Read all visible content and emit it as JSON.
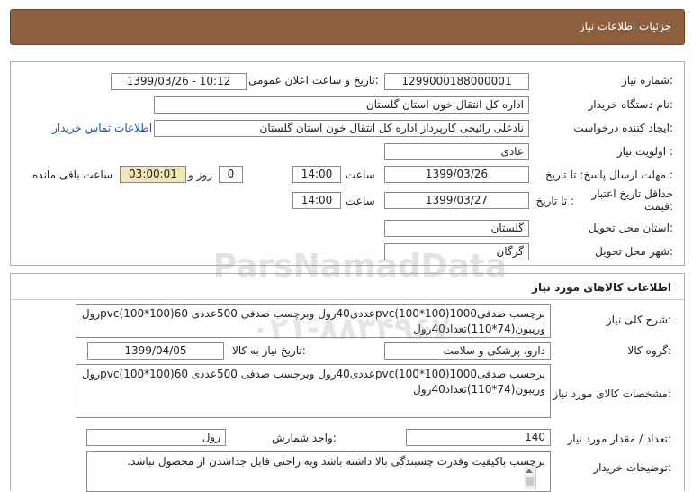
{
  "header": {
    "title": "جزئیات اطلاعات نیاز"
  },
  "need_info": {
    "need_number_label": "شماره نیاز:",
    "need_number": "1299000188000001",
    "announce_label": "تاریخ و ساعت اعلان عمومی:",
    "announce_value": "1399/03/26 - 10:12",
    "buyer_org_label": "نام دستگاه خریدار:",
    "buyer_org": "اداره کل انتقال خون استان گلستان",
    "creator_label": "ایجاد کننده درخواست:",
    "creator": "نادعلی رائیجی کارپرداز اداره کل انتقال خون استان گلستان",
    "contact_link": "اطلاعات تماس خریدار",
    "priority_label": "اولویت نیاز :",
    "priority": "عادی",
    "deadline_label": "مهلت ارسال پاسخ: تا تاریخ :",
    "deadline_date": "1399/03/26",
    "time_label": "ساعت",
    "deadline_time": "14:00",
    "days_value": "0",
    "days_label": "روز و",
    "remaining_value": "03:00:01",
    "remaining_label": "ساعت باقی مانده",
    "validity_label": "حداقل تاریخ اعتبار قیمت:",
    "validity_to_label": "تا تاریخ :",
    "validity_date": "1399/03/27",
    "validity_time": "14:00",
    "province_label": "استان محل تحویل:",
    "province": "گلستان",
    "city_label": "شهر محل تحویل:",
    "city": "گرگان"
  },
  "goods": {
    "section_title": "اطلاعات کالاهای مورد نیاز",
    "summary_label": "شرح کلی نیاز:",
    "summary": "برچسب صدفی1000(100*100)pvcعددی40رول وبرچسب صدفی 500عددی 60(100*100)pvcرول وریبون(74*110)تعداد40رول",
    "group_label": "گروه کالا:",
    "group": "دارو، پزشکی و سلامت",
    "need_date_label": "تاریخ نیاز به کالا:",
    "need_date": "1399/04/05",
    "spec_label": "مشخصات کالای مورد نیاز:",
    "spec": "برچسب صدفی1000(100*100)pvcعددی40رول وبرچسب صدفی 500عددی 60(100*100)pvcرول وریبون(74*110)تعداد40رول",
    "qty_label": "تعداد / مقدار مورد نیاز:",
    "qty": "140",
    "unit_label": "واحد شمارش:",
    "unit": "رول",
    "notes_label": "توضیحات خریدار:",
    "notes": "برچسب باکیفیت وقدرت چسبندگی بالا داشته باشد وبه راحتی قابل جداشدن از محصول نباشد."
  },
  "watermark": {
    "line1": "ParsNamadData",
    "line2": "۰۲۱-۸۸۳۴۹۶۷۰"
  },
  "colors": {
    "header_bg": "#8d5f3f",
    "remaining_bg": "#f3e7b5",
    "link": "#1a4fa3"
  }
}
